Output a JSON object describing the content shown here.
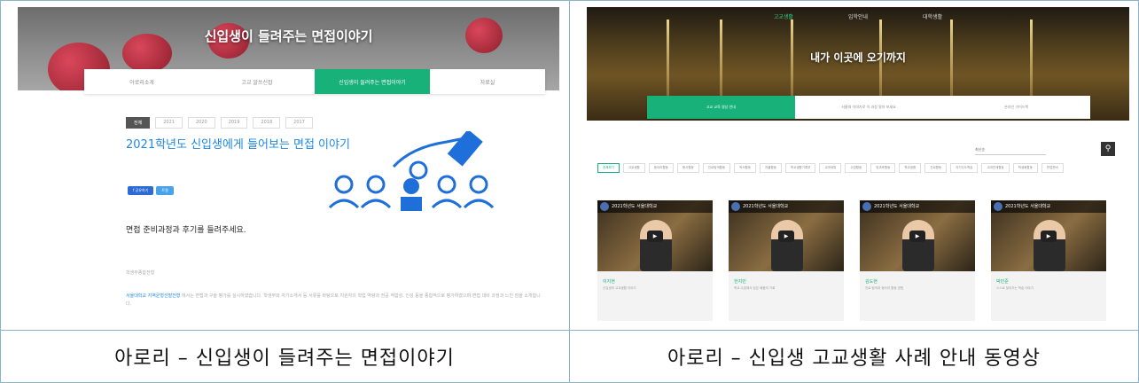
{
  "left_screenshot": {
    "hero_title": "신입생이 들려주는 면접이야기",
    "tabs": [
      "아로리소개",
      "고교 알쓰신잡",
      "신입생이 들려주는 면접이야기",
      "자료실"
    ],
    "active_tab": 2,
    "year_chips": [
      "전체",
      "2021",
      "2020",
      "2019",
      "2018",
      "2017"
    ],
    "active_year": 0,
    "heading": "2021학년도 신입생에게 들어보는 면접 이야기",
    "share_buttons": [
      "f 공유하기",
      "트윗"
    ],
    "subtitle": "면접 준비과정과 후기를 들려주세요.",
    "section_label": "학생부종합전형",
    "paragraph_highlight": "서울대학교 지역균형선발전형",
    "paragraph_text": "에서는 면접과 구술 평가를 실시하였습니다. 학생부와 자기소개서 등 서류를 바탕으로 지원자의 학업 역량과 전공 적합성, 인성 등을 종합적으로 평가하였으며 면접 대비 과정과 느낀 점을 소개합니다."
  },
  "right_screenshot": {
    "nav": [
      "고교생활",
      "입학안내",
      "대학생활"
    ],
    "active_nav": 0,
    "hero_title": "내가 이곳에 오기까지",
    "tabs": [
      "고교 교육 영상 안내",
      "서울대 이야기로 이 과정 알아 보세요",
      "온라인 가이드북"
    ],
    "active_tab": 0,
    "sort_label": "최신순",
    "filters": [
      "전체보기",
      "고교생활",
      "동아리활동",
      "봉사활동",
      "진로탐색활동",
      "독서활동",
      "자율활동",
      "학교생활기록부",
      "교과세특",
      "수업활동",
      "방과후활동",
      "학교생활",
      "진로활동",
      "자기주도학습",
      "교과연계활동",
      "학생회활동",
      "면접준비"
    ],
    "active_filter": 0,
    "video_title": "2021학년도 서울대학교",
    "cards": [
      {
        "name": "이지현",
        "desc": "신입생의 고교생활 이야기"
      },
      {
        "name": "한지민",
        "desc": "학교 수업에서 얻은 배움의 기회"
      },
      {
        "name": "김도현",
        "desc": "진로 탐색과 동아리 활동 경험"
      },
      {
        "name": "박민준",
        "desc": "스스로 찾아가는 학습 이야기"
      }
    ]
  },
  "captions": {
    "left": "아로리 – 신입생이 들려주는 면접이야기",
    "right": "아로리 – 신입생 고교생활 사례 안내 동영상"
  },
  "colors": {
    "accent_green": "#19b17a",
    "accent_blue": "#1e88e5"
  }
}
